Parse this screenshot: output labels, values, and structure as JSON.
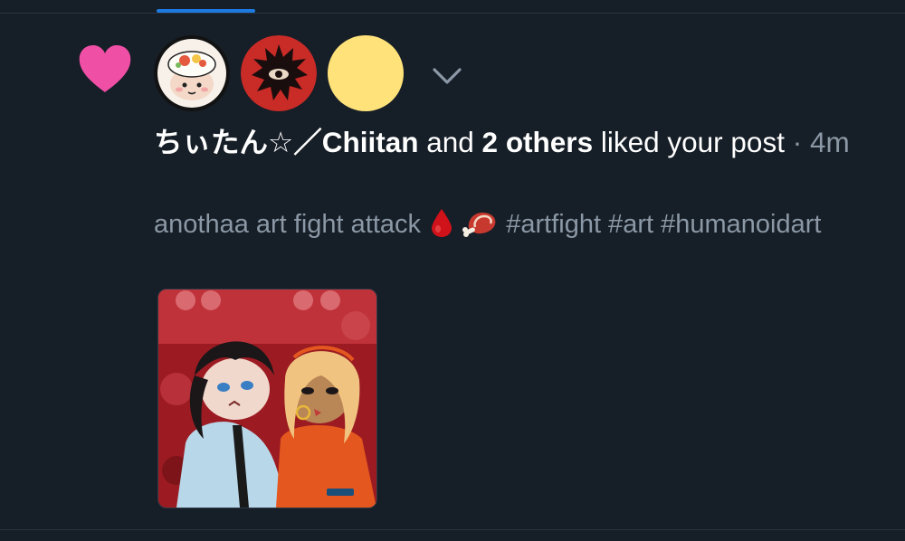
{
  "notification": {
    "type_icon": "heart-icon",
    "accent_color": "#f04fa6",
    "liker_name": "ちぃたん☆／Chiitan",
    "connector_text": " and ",
    "others_text": "2 others",
    "action_text": " liked your post",
    "separator": " · ",
    "time_ago": "4m",
    "preview_text": "anothaa art fight attack",
    "preview_emoji_1": "drop-of-blood-icon",
    "preview_emoji_2": "meat-on-bone-icon",
    "hashtags": "#artfight #art #humanoidart",
    "avatars": [
      {
        "icon": "avatar-cat-with-food-icon",
        "bg": "#c23b2b"
      },
      {
        "icon": "avatar-black-sun-eye-icon",
        "bg": "#cf2e2e"
      },
      {
        "icon": "avatar-plain-yellow",
        "bg": "#ffe27a"
      }
    ],
    "expand_icon": "chevron-down-icon"
  },
  "colors": {
    "background": "#161e27",
    "tab_indicator": "#1d7ae0",
    "primary_text": "#ffffff",
    "secondary_text": "#8b98a5"
  }
}
